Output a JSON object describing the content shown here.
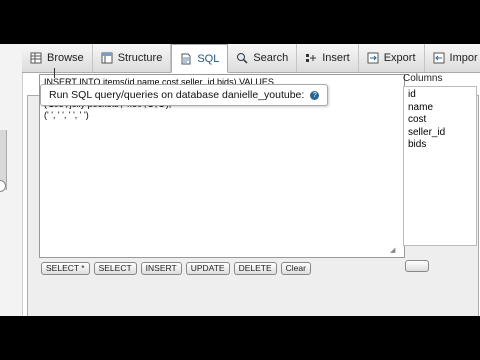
{
  "tabs": [
    {
      "label": "Browse",
      "icon": "browse-icon"
    },
    {
      "label": "Structure",
      "icon": "structure-icon"
    },
    {
      "label": "SQL",
      "icon": "sql-icon"
    },
    {
      "label": "Search",
      "icon": "search-icon"
    },
    {
      "label": "Insert",
      "icon": "insert-icon"
    },
    {
      "label": "Export",
      "icon": "export-icon"
    },
    {
      "label": "Impor",
      "icon": "import-icon"
    }
  ],
  "legend": {
    "text": "Run SQL query/queries on database danielle_youtube:"
  },
  "query": {
    "text": "INSERT INTO items(id,name,cost,seller_id,bids) VALUES\n('104','beef chops','7.99','1','0'),\n('105','jelly pockets','4.50','1','1'),\n(' ', ' ', ' ', ' ')"
  },
  "columns": {
    "label": "Columns",
    "items": [
      "id",
      "name",
      "cost",
      "seller_id",
      "bids"
    ]
  },
  "buttons": [
    "SELECT *",
    "SELECT",
    "INSERT",
    "UPDATE",
    "DELETE",
    "Clear"
  ]
}
